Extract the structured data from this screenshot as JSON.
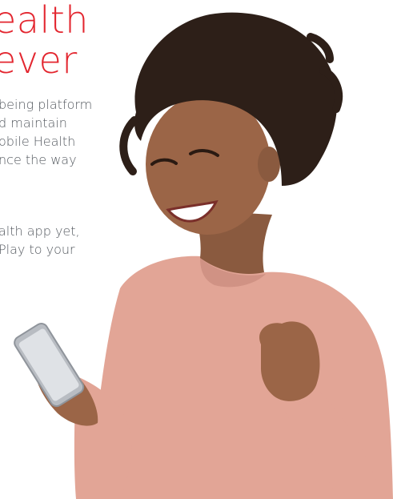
{
  "headline": {
    "line1": "ealth",
    "line2": "ever"
  },
  "paragraph1": {
    "lines": [
      "being platform",
      "d maintain",
      "obile Health",
      "nce the way"
    ]
  },
  "paragraph2": {
    "lines": [
      "alth app yet,",
      "Play to your"
    ]
  },
  "colors": {
    "accent": "#e3262f",
    "body_text": "#555a60",
    "sweater": "#e2a596"
  },
  "icons": {
    "phone": "smartphone-icon"
  }
}
